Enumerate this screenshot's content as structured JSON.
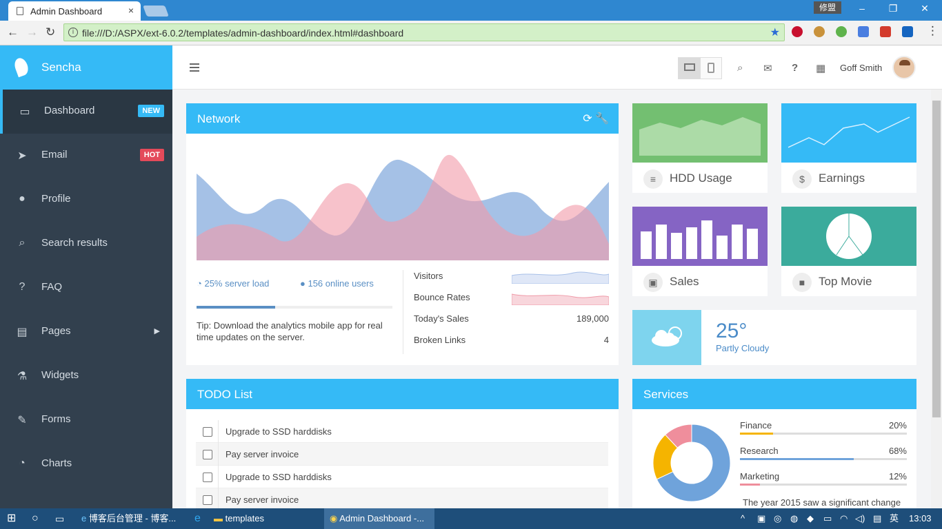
{
  "browser": {
    "tab_title": "Admin Dashboard",
    "tab_close": "×",
    "ime": "修盟",
    "url": "file:///D:/ASPX/ext-6.0.2/templates/admin-dashboard/index.html#dashboard"
  },
  "brand": {
    "name": "Sencha",
    "color": "#35baf6"
  },
  "sidebar": {
    "items": [
      {
        "label": "Dashboard",
        "icon": "monitor-icon",
        "badge": "NEW",
        "badge_color": "#35baf6"
      },
      {
        "label": "Email",
        "icon": "paper-plane-icon",
        "badge": "HOT",
        "badge_color": "#e44a5a"
      },
      {
        "label": "Profile",
        "icon": "user-icon"
      },
      {
        "label": "Search results",
        "icon": "search-icon"
      },
      {
        "label": "FAQ",
        "icon": "question-icon"
      },
      {
        "label": "Pages",
        "icon": "book-icon"
      },
      {
        "label": "Widgets",
        "icon": "flask-icon"
      },
      {
        "label": "Forms",
        "icon": "edit-icon"
      },
      {
        "label": "Charts",
        "icon": "pie-icon"
      }
    ]
  },
  "topbar": {
    "user_name": "Goff Smith"
  },
  "network": {
    "title": "Network",
    "server_load": "25% server load",
    "online_users": "156 online users",
    "progress": 0.4,
    "tip": "Tip: Download the analytics mobile app for real time updates on the server.",
    "stats": [
      {
        "label": "Visitors",
        "value": ""
      },
      {
        "label": "Bounce Rates",
        "value": ""
      },
      {
        "label": "Today's Sales",
        "value": "189,000"
      },
      {
        "label": "Broken Links",
        "value": "4"
      }
    ]
  },
  "tiles": [
    {
      "label": "HDD Usage",
      "icon": "database-icon",
      "color": "#73bf71"
    },
    {
      "label": "Earnings",
      "icon": "dollar-icon",
      "color": "#35baf6"
    },
    {
      "label": "Sales",
      "icon": "briefcase-icon",
      "color": "#8564c4"
    },
    {
      "label": "Top Movie",
      "icon": "video-icon",
      "color": "#3bab9c"
    }
  ],
  "weather": {
    "temp": "25°",
    "desc": "Partly Cloudy"
  },
  "todo": {
    "title": "TODO List",
    "items": [
      "Upgrade to SSD harddisks",
      "Pay server invoice",
      "Upgrade to SSD harddisks",
      "Pay server invoice"
    ]
  },
  "services": {
    "title": "Services",
    "items": [
      {
        "name": "Finance",
        "pct": "20%",
        "value": 0.2,
        "color": "#f5b400"
      },
      {
        "name": "Research",
        "pct": "68%",
        "value": 0.68,
        "color": "#6fa3db"
      },
      {
        "name": "Marketing",
        "pct": "12%",
        "value": 0.12,
        "color": "#ef8e9c"
      }
    ],
    "note": "The year 2015 saw a significant change"
  },
  "taskbar": {
    "items": [
      "博客后台管理 - 博客...",
      "templates",
      "Admin Dashboard -..."
    ],
    "lang": "英",
    "time": "13:03"
  }
}
